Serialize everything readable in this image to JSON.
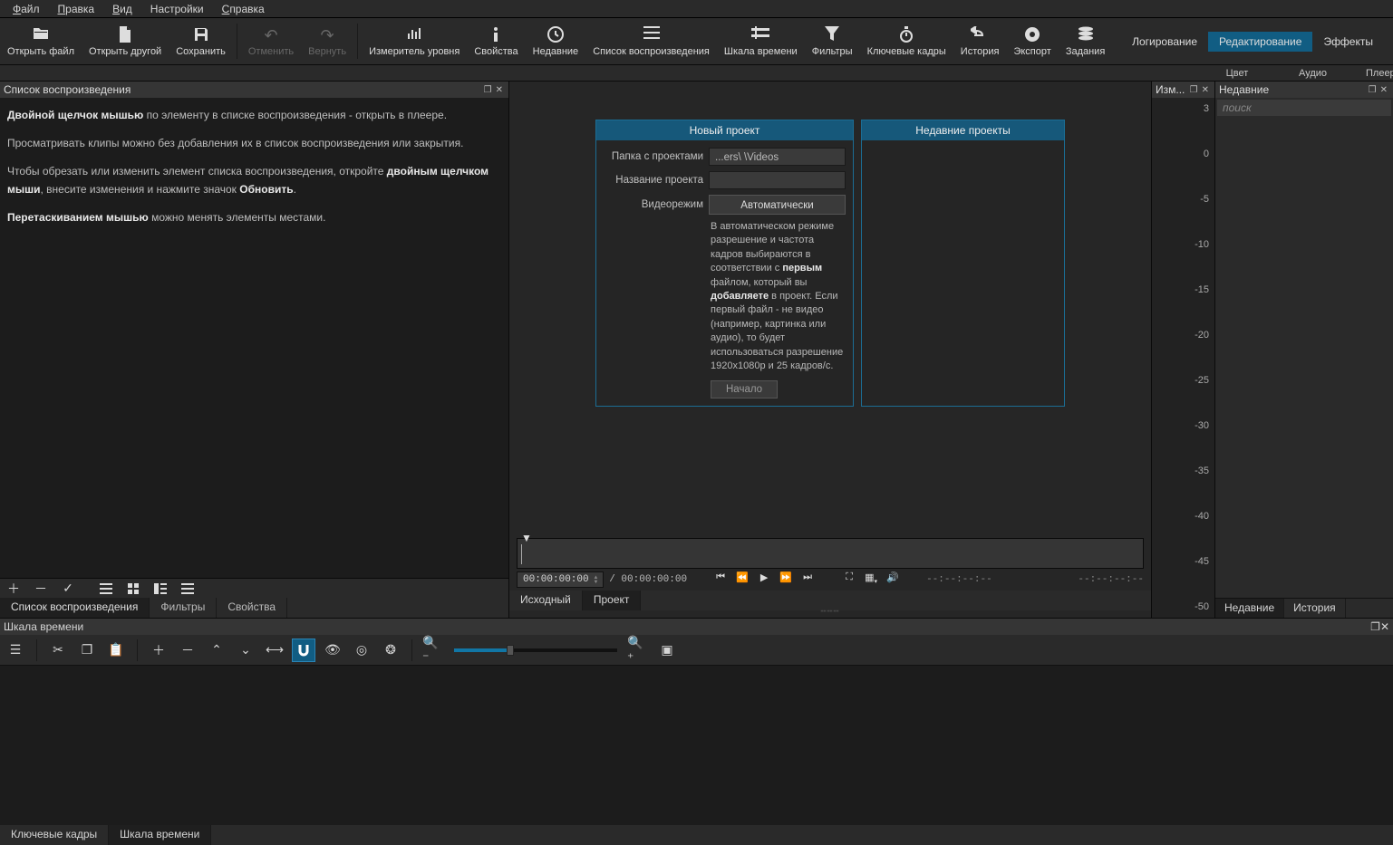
{
  "menu": {
    "file": "Файл",
    "edit": "Правка",
    "view": "Вид",
    "settings": "Настройки",
    "help": "Справка"
  },
  "toolbar": {
    "open_file": "Открыть файл",
    "open_other": "Открыть другой",
    "save": "Сохранить",
    "undo": "Отменить",
    "redo": "Вернуть",
    "level_meter": "Измеритель уровня",
    "properties": "Свойства",
    "recent": "Недавние",
    "playlist": "Список воспроизведения",
    "timeline": "Шкала времени",
    "filters": "Фильтры",
    "keyframes": "Ключевые кадры",
    "history": "История",
    "export": "Экспорт",
    "jobs": "Задания"
  },
  "modes": {
    "logging": "Логирование",
    "editing": "Редактирование",
    "effects": "Эффекты"
  },
  "secondbar": {
    "color": "Цвет",
    "audio": "Аудио",
    "player": "Плеер"
  },
  "playlist_panel": {
    "title": "Список воспроизведения",
    "help1_b": "Двойной щелчок мышью",
    "help1": " по элементу в списке воспроизведения - открыть в плеере.",
    "help2": "Просматривать клипы можно без добавления их в список воспроизведения или закрытия.",
    "help3a": "Чтобы обрезать или изменить элемент списка воспроизведения, откройте ",
    "help3b": "двойным щелчком мыши",
    "help3c": ", внесите изменения и нажмите значок ",
    "help3d": "Обновить",
    "help4b": "Перетаскиванием мышью",
    "help4": " можно менять элементы местами.",
    "tabs": {
      "playlist": "Список воспроизведения",
      "filters": "Фильтры",
      "props": "Свойства"
    }
  },
  "center": {
    "new_project": "Новый проект",
    "recent_projects": "Недавние проекты",
    "projects_folder": "Папка с проектами",
    "projects_folder_val": "...ers\\                      \\Videos",
    "project_name": "Название проекта",
    "project_name_val": "",
    "video_mode": "Видеорежим",
    "video_mode_val": "Автоматически",
    "note": "В автоматическом режиме разрешение и частота кадров выбираются в соответствии с ",
    "note_b1": "первым",
    "note2": " файлом, который вы ",
    "note_b2": "добавляете",
    "note3": " в проект. Если первый файл - не видео (например, картинка или аудио), то будет использоваться разрешение 1920x1080p и 25 кадров/с.",
    "start": "Начало",
    "timecode": "00:00:00:00",
    "duration": "/ 00:00:00:00",
    "tc_dash": "--:--:--:--",
    "tabs": {
      "source": "Исходный",
      "project": "Проект"
    }
  },
  "meter": {
    "title": "Изм...",
    "values": [
      "3",
      "0",
      "-5",
      "-10",
      "-15",
      "-20",
      "-25",
      "-30",
      "-35",
      "-40",
      "-45",
      "-50"
    ]
  },
  "recent_panel": {
    "title": "Недавние",
    "search_ph": "поиск",
    "tabs": {
      "recent": "Недавние",
      "history": "История"
    }
  },
  "timeline": {
    "title": "Шкала времени",
    "tabs": {
      "keyframes": "Ключевые кадры",
      "timeline": "Шкала времени"
    }
  }
}
